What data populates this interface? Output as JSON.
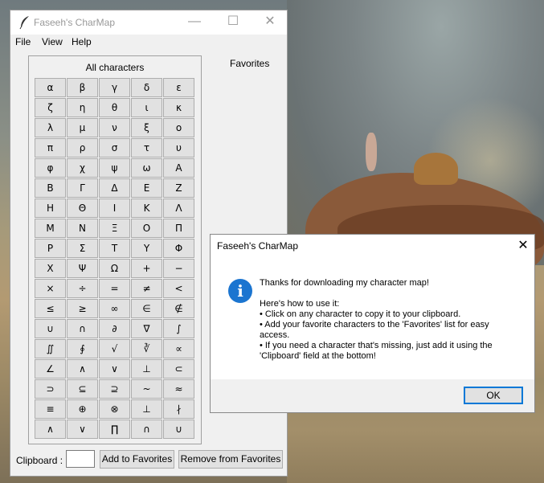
{
  "window": {
    "title": "Faseeh's CharMap",
    "controls": {
      "minimize": "—",
      "maximize": "☐",
      "close": "✕"
    }
  },
  "menu": [
    "File",
    "View",
    "Help"
  ],
  "group_title": "All characters",
  "favorites_label": "Favorites",
  "characters": [
    "α",
    "β",
    "γ",
    "δ",
    "ε",
    "ζ",
    "η",
    "θ",
    "ι",
    "κ",
    "λ",
    "μ",
    "ν",
    "ξ",
    "ο",
    "π",
    "ρ",
    "σ",
    "τ",
    "υ",
    "φ",
    "χ",
    "ψ",
    "ω",
    "Α",
    "Β",
    "Γ",
    "Δ",
    "Ε",
    "Ζ",
    "Η",
    "Θ",
    "Ι",
    "Κ",
    "Λ",
    "Μ",
    "Ν",
    "Ξ",
    "Ο",
    "Π",
    "Ρ",
    "Σ",
    "Τ",
    "Υ",
    "Φ",
    "Χ",
    "Ψ",
    "Ω",
    "+",
    "−",
    "×",
    "÷",
    "=",
    "≠",
    "<",
    "≤",
    "≥",
    "∞",
    "∈",
    "∉",
    "∪",
    "∩",
    "∂",
    "∇",
    "∫",
    "∬",
    "∮",
    "√",
    "∛",
    "∝",
    "∠",
    "∧",
    "∨",
    "⊥",
    "⊂",
    "⊃",
    "⊆",
    "⊇",
    "~",
    "≈",
    "≡",
    "⊕",
    "⊗",
    "⊥",
    "∤",
    "∧",
    "∨",
    "∏",
    "∩",
    "∪"
  ],
  "bottom": {
    "clipboard_label": "Clipboard :",
    "clipboard_value": "",
    "add_favorites": "Add to Favorites",
    "remove_favorites": "Remove from Favorites"
  },
  "dialog": {
    "title": "Faseeh's CharMap",
    "close": "✕",
    "icon": "info-icon",
    "lines": [
      "Thanks for downloading my character map!",
      "",
      "Here's how to use it:",
      "• Click on any character to copy it to your clipboard.",
      "• Add your favorite characters to the 'Favorites' list for easy",
      "access.",
      "• If you need a character that's missing, just add it using the",
      "'Clipboard' field at the bottom!"
    ],
    "ok": "OK"
  }
}
